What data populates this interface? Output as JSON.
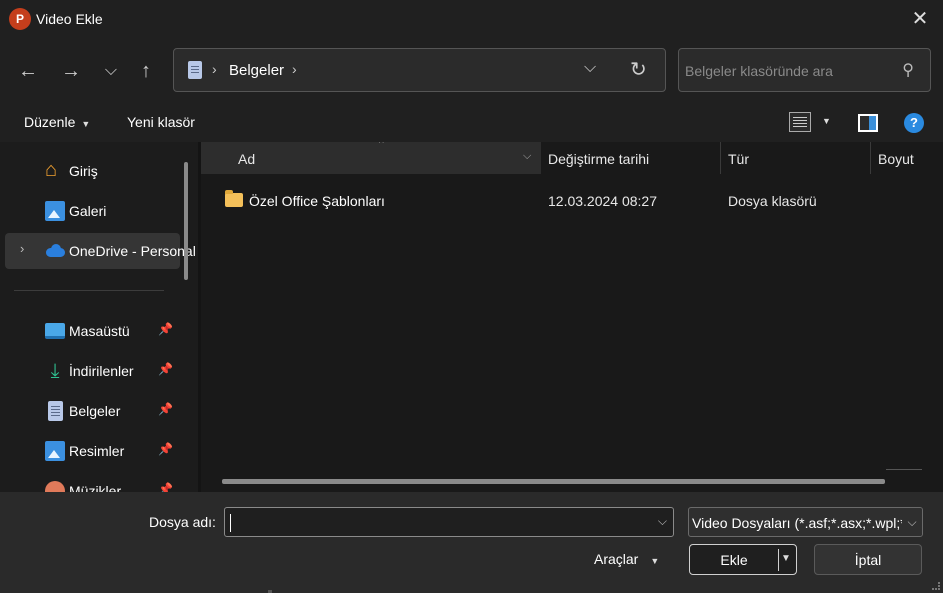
{
  "window": {
    "title": "Video Ekle",
    "app_icon_letter": "P",
    "close_glyph": "✕"
  },
  "nav": {
    "back_glyph": "←",
    "forward_glyph": "→",
    "recent_glyph": "⌵",
    "up_glyph": "↑"
  },
  "address": {
    "sep_glyph": "›",
    "path": "Belgeler",
    "chevron_glyph": "⌵",
    "refresh_glyph": "↻"
  },
  "search": {
    "placeholder": "Belgeler klasöründe ara",
    "icon_glyph": "⚲"
  },
  "commandbar": {
    "organize_label": "Düzenle",
    "new_folder_label": "Yeni klasör",
    "caret_glyph": "▼",
    "help_glyph": "?"
  },
  "sidebar": {
    "expand_glyph": "›",
    "pin_glyph": "📌",
    "items": [
      {
        "label": "Giriş",
        "icon": "home-icon"
      },
      {
        "label": "Galeri",
        "icon": "gallery-icon"
      },
      {
        "label": "OneDrive - Personal",
        "icon": "onedrive-icon"
      },
      {
        "label": "Masaüstü",
        "icon": "desktop-icon",
        "pinned": true
      },
      {
        "label": "İndirilenler",
        "icon": "download-icon",
        "pinned": true
      },
      {
        "label": "Belgeler",
        "icon": "documents-icon",
        "pinned": true
      },
      {
        "label": "Resimler",
        "icon": "pictures-icon",
        "pinned": true
      },
      {
        "label": "Müzikler",
        "icon": "music-icon",
        "pinned": true
      }
    ],
    "home_glyph": "⌂",
    "download_glyph": "⤓"
  },
  "filelist": {
    "columns": [
      "Ad",
      "Değiştirme tarihi",
      "Tür",
      "Boyut"
    ],
    "sort_glyph": "^",
    "col_chev_glyph": "⌵",
    "rows": [
      {
        "name": "Özel Office Şablonları",
        "modified": "12.03.2024 08:27",
        "type": "Dosya klasörü",
        "size": ""
      }
    ]
  },
  "footer": {
    "filename_label": "Dosya adı:",
    "filename_value": "",
    "filename_chev": "⌵",
    "filetype_value": "Video Dosyaları (*.asf;*.asx;*.wpl;*.wm;*.wmx;*.wmd;*.wmz)",
    "filetype_chev": "⌵",
    "tools_label": "Araçlar",
    "tools_caret": "▼",
    "ok_label": "Ekle",
    "ok_caret": "▼",
    "cancel_label": "İptal"
  }
}
